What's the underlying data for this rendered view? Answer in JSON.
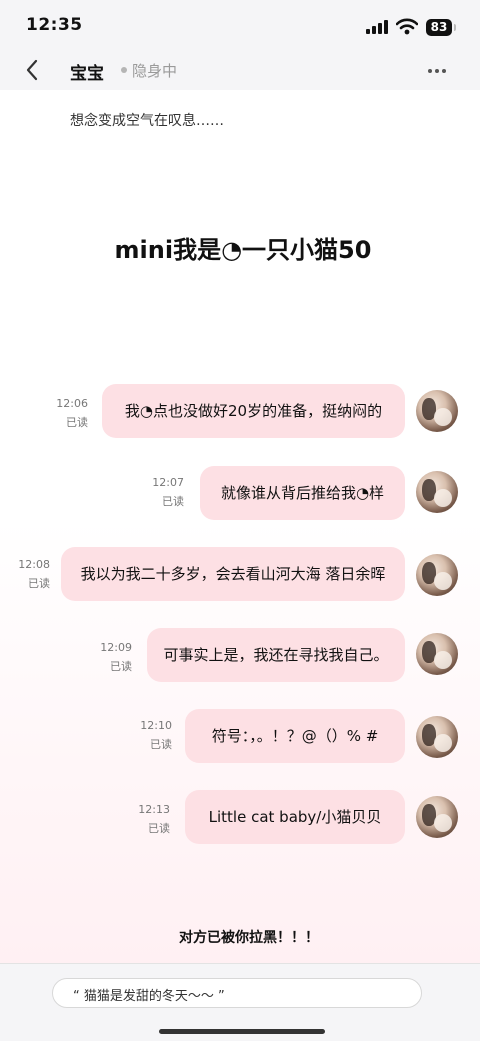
{
  "status_bar": {
    "time": "12:35",
    "battery": "83"
  },
  "header": {
    "contact_name": "宝宝",
    "presence": "隐身中"
  },
  "profile": {
    "signature": "想念变成空气在叹息……",
    "title": "mini我是◔一只小猫50"
  },
  "messages": [
    {
      "time": "12:06",
      "read": "已读",
      "text": "我◔点也没做好20岁的准备，挺纳闷的"
    },
    {
      "time": "12:07",
      "read": "已读",
      "text": "就像谁从背后推给我◔样"
    },
    {
      "time": "12:08",
      "read": "已读",
      "text": "我以为我二十多岁，会去看山河大海 落日余晖"
    },
    {
      "time": "12:09",
      "read": "已读",
      "text": "可事实上是，我还在寻找我自己。"
    },
    {
      "time": "12:10",
      "read": "已读",
      "text": "符号：，。！？@（）% #"
    },
    {
      "time": "12:13",
      "read": "已读",
      "text": "Little cat baby/小猫贝贝"
    }
  ],
  "notice": "对方已被你拉黑！！！",
  "input": {
    "text": "“ 猫猫是发甜的冬天～～ ”"
  },
  "icons": {
    "back": "chevron-left-icon",
    "more": "more-horizontal-icon",
    "signal": "signal-icon",
    "wifi": "wifi-icon",
    "battery": "battery-icon"
  }
}
